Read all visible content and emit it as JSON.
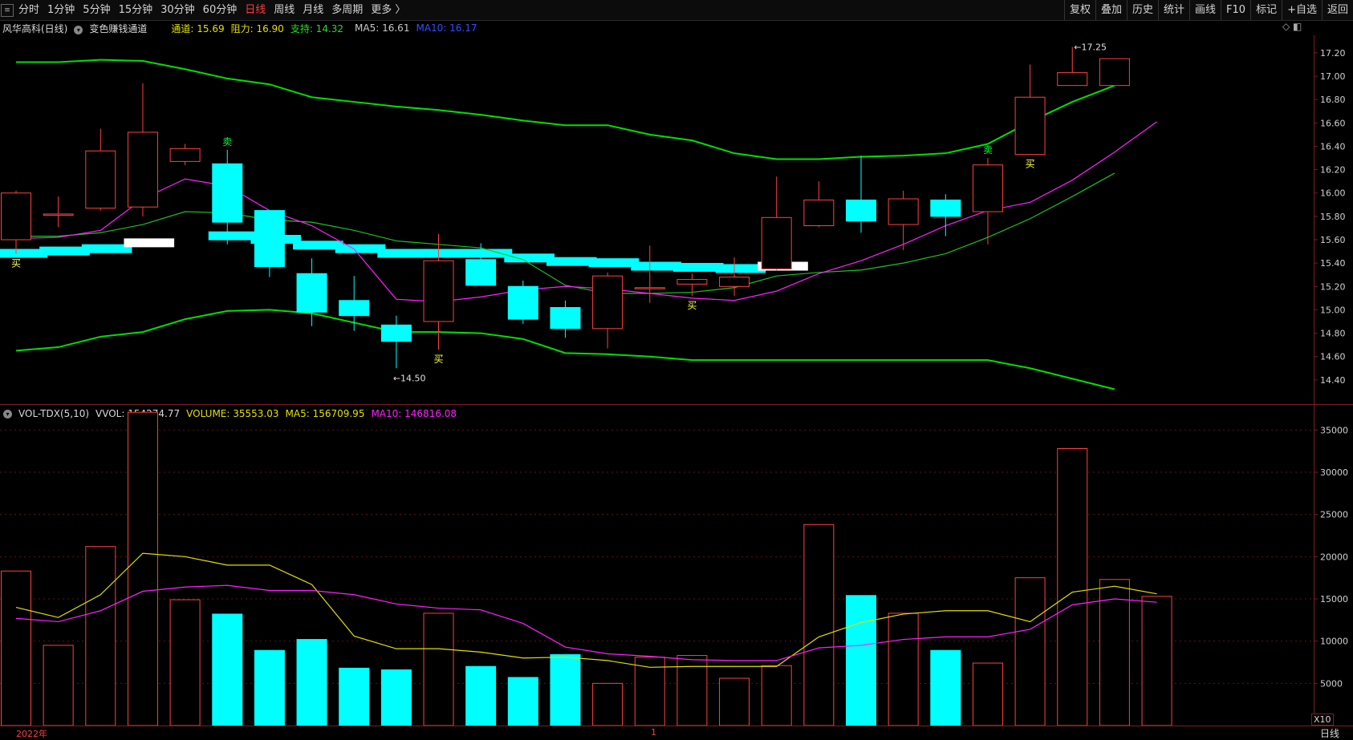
{
  "toolbar": {
    "icon": "≡",
    "periods": [
      "分时",
      "1分钟",
      "5分钟",
      "15分钟",
      "30分钟",
      "60分钟",
      "日线",
      "周线",
      "月线",
      "多周期",
      "更多 〉"
    ],
    "active_period": "日线",
    "right_buttons": [
      "复权",
      "叠加",
      "历史",
      "统计",
      "画线",
      "F10",
      "标记",
      "+自选",
      "返回"
    ]
  },
  "price_panel": {
    "stock_name": "风华高科(日线)",
    "indicator": "变色赚钱通道",
    "channel_label": "通道: 15.69",
    "resist_label": "阻力: 16.90",
    "support_label": "支持: 14.32",
    "ma5_label": "MA5: 16.61",
    "ma10_label": "MA10: 16.17",
    "corner_icons": "◇ ◧",
    "high_marker": "17.25",
    "low_marker": "14.50",
    "buy_label": "买",
    "sell_label": "卖"
  },
  "volume_panel": {
    "name": "VOL-TDX(5,10)",
    "vvol": "VVOL: 154274.77",
    "volume": "VOLUME: 35553.03",
    "ma5": "MA5: 156709.95",
    "ma10": "MA10: 146816.08",
    "scale_label": "X10"
  },
  "footer": {
    "year_label": "2022年",
    "month_label": "1",
    "period_label": "日线"
  },
  "colors": {
    "up": "#ff4040",
    "down": "#00ffff",
    "ma5": "#e0e000",
    "ma10": "#ff20ff",
    "channel": "#00e000",
    "buy": "#ffff40",
    "sell": "#00ff40"
  },
  "chart_data": [
    {
      "type": "candlestick",
      "title": "风华高科(日线)",
      "ylim": [
        14.2,
        17.35
      ],
      "yticks": [
        14.4,
        14.6,
        14.8,
        15.0,
        15.2,
        15.4,
        15.6,
        15.8,
        16.0,
        16.2,
        16.4,
        16.6,
        16.8,
        17.0,
        17.2
      ],
      "candles": [
        {
          "o": 15.6,
          "h": 16.02,
          "l": 15.48,
          "c": 16.0
        },
        {
          "o": 15.82,
          "h": 15.97,
          "l": 15.71,
          "c": 15.82
        },
        {
          "o": 15.87,
          "h": 16.55,
          "l": 15.85,
          "c": 16.36
        },
        {
          "o": 15.88,
          "h": 16.94,
          "l": 15.8,
          "c": 16.52
        },
        {
          "o": 16.27,
          "h": 16.42,
          "l": 16.24,
          "c": 16.38
        },
        {
          "o": 16.25,
          "h": 16.37,
          "l": 15.56,
          "c": 15.75
        },
        {
          "o": 15.85,
          "h": 15.82,
          "l": 15.28,
          "c": 15.37
        },
        {
          "o": 15.31,
          "h": 15.44,
          "l": 14.86,
          "c": 14.98
        },
        {
          "o": 15.08,
          "h": 15.29,
          "l": 14.82,
          "c": 14.95
        },
        {
          "o": 14.87,
          "h": 14.95,
          "l": 14.5,
          "c": 14.73
        },
        {
          "o": 14.9,
          "h": 15.65,
          "l": 14.66,
          "c": 15.42
        },
        {
          "o": 15.43,
          "h": 15.57,
          "l": 15.28,
          "c": 15.21
        },
        {
          "o": 15.2,
          "h": 15.25,
          "l": 14.88,
          "c": 14.92
        },
        {
          "o": 15.02,
          "h": 15.08,
          "l": 14.76,
          "c": 14.84
        },
        {
          "o": 14.84,
          "h": 15.32,
          "l": 14.67,
          "c": 15.29
        },
        {
          "o": 15.19,
          "h": 15.55,
          "l": 15.06,
          "c": 15.19
        },
        {
          "o": 15.22,
          "h": 15.31,
          "l": 15.12,
          "c": 15.26
        },
        {
          "o": 15.2,
          "h": 15.45,
          "l": 15.12,
          "c": 15.28
        },
        {
          "o": 15.35,
          "h": 16.14,
          "l": 15.34,
          "c": 15.79
        },
        {
          "o": 15.72,
          "h": 16.1,
          "l": 15.71,
          "c": 15.94
        },
        {
          "o": 15.94,
          "h": 16.32,
          "l": 15.66,
          "c": 15.76
        },
        {
          "o": 15.73,
          "h": 16.02,
          "l": 15.51,
          "c": 15.95
        },
        {
          "o": 15.94,
          "h": 15.99,
          "l": 15.63,
          "c": 15.8
        },
        {
          "o": 15.84,
          "h": 16.3,
          "l": 15.56,
          "c": 16.24
        },
        {
          "o": 16.33,
          "h": 17.1,
          "l": 16.33,
          "c": 16.82
        },
        {
          "o": 16.92,
          "h": 17.25,
          "l": 16.92,
          "c": 17.03
        },
        {
          "o": 16.92,
          "h": 17.15,
          "l": 16.92,
          "c": 17.15
        }
      ],
      "ma5": [
        15.61,
        15.62,
        15.68,
        15.95,
        16.12,
        16.06,
        15.85,
        15.72,
        15.52,
        15.09,
        15.07,
        15.11,
        15.17,
        15.2,
        15.18,
        15.14,
        15.1,
        15.08,
        15.16,
        15.31,
        15.42,
        15.56,
        15.72,
        15.85,
        15.92,
        16.11,
        16.35,
        16.61
      ],
      "ma10": [
        15.63,
        15.63,
        15.66,
        15.73,
        15.84,
        15.83,
        15.77,
        15.75,
        15.68,
        15.59,
        15.56,
        15.53,
        15.43,
        15.21,
        15.14,
        15.14,
        15.15,
        15.19,
        15.29,
        15.32,
        15.34,
        15.4,
        15.48,
        15.62,
        15.78,
        15.97,
        16.17
      ],
      "upper_band": [
        17.12,
        17.12,
        17.14,
        17.13,
        17.06,
        16.98,
        16.93,
        16.82,
        16.78,
        16.74,
        16.71,
        16.67,
        16.62,
        16.58,
        16.58,
        16.5,
        16.45,
        16.34,
        16.29,
        16.29,
        16.31,
        16.32,
        16.34,
        16.42,
        16.61,
        16.78,
        16.92
      ],
      "lower_band": [
        14.65,
        14.68,
        14.77,
        14.81,
        14.92,
        14.99,
        15.0,
        14.97,
        14.89,
        14.81,
        14.81,
        14.8,
        14.75,
        14.63,
        14.62,
        14.6,
        14.57,
        14.57,
        14.57,
        14.57,
        14.57,
        14.57,
        14.57,
        14.57,
        14.5,
        14.41,
        14.32
      ],
      "channel_blocks": [
        {
          "from": 0,
          "to": 1,
          "v": 15.48,
          "color": "#00ffff"
        },
        {
          "from": 1,
          "to": 2,
          "v": 15.5,
          "color": "#00ffff"
        },
        {
          "from": 2,
          "to": 3,
          "v": 15.52,
          "color": "#00ffff"
        },
        {
          "from": 3,
          "to": 4,
          "v": 15.57,
          "color": "#ffffff"
        },
        {
          "from": 5,
          "to": 6,
          "v": 15.63,
          "color": "#00ffff"
        },
        {
          "from": 6,
          "to": 7,
          "v": 15.6,
          "color": "#00ffff"
        },
        {
          "from": 7,
          "to": 8,
          "v": 15.55,
          "color": "#00ffff"
        },
        {
          "from": 8,
          "to": 9,
          "v": 15.52,
          "color": "#00ffff"
        },
        {
          "from": 9,
          "to": 10,
          "v": 15.48,
          "color": "#00ffff"
        },
        {
          "from": 10,
          "to": 11,
          "v": 15.48,
          "color": "#00ffff"
        },
        {
          "from": 11,
          "to": 12,
          "v": 15.48,
          "color": "#00ffff"
        },
        {
          "from": 12,
          "to": 13,
          "v": 15.44,
          "color": "#00ffff"
        },
        {
          "from": 13,
          "to": 14,
          "v": 15.41,
          "color": "#00ffff"
        },
        {
          "from": 14,
          "to": 15,
          "v": 15.4,
          "color": "#00ffff"
        },
        {
          "from": 15,
          "to": 16,
          "v": 15.37,
          "color": "#00ffff"
        },
        {
          "from": 16,
          "to": 17,
          "v": 15.36,
          "color": "#00ffff"
        },
        {
          "from": 17,
          "to": 18,
          "v": 15.35,
          "color": "#00ffff"
        },
        {
          "from": 18,
          "to": 19,
          "v": 15.37,
          "color": "#ffffff"
        }
      ],
      "buy_signals": [
        0,
        10,
        16,
        24
      ],
      "sell_signals": [
        5,
        23
      ]
    },
    {
      "type": "bar",
      "title": "VOL-TDX(5,10)",
      "ylim": [
        0,
        37500
      ],
      "yticks": [
        5000,
        10000,
        15000,
        20000,
        25000,
        30000,
        35000
      ],
      "volumes": [
        18300,
        9500,
        21200,
        37100,
        14900,
        13200,
        8900,
        10200,
        6800,
        6600,
        13300,
        7000,
        5700,
        8400,
        5000,
        8100,
        8300,
        5600,
        7100,
        23800,
        15400,
        13300,
        8900,
        7400,
        17500,
        32800,
        17300,
        15300
      ],
      "vol_ma5": [
        14000,
        12800,
        15500,
        20400,
        20000,
        19000,
        19000,
        16700,
        10600,
        9100,
        9100,
        8700,
        8000,
        8100,
        7700,
        6900,
        7000,
        7000,
        7000,
        10500,
        12200,
        13200,
        13600,
        13600,
        12300,
        15800,
        16500,
        15600
      ],
      "vol_ma10": [
        12700,
        12300,
        13600,
        15900,
        16400,
        16600,
        16000,
        16000,
        15500,
        14400,
        13900,
        13700,
        12100,
        9300,
        8500,
        8200,
        7800,
        7700,
        7700,
        9200,
        9500,
        10200,
        10500,
        10500,
        11400,
        14300,
        15000,
        14600
      ]
    }
  ]
}
